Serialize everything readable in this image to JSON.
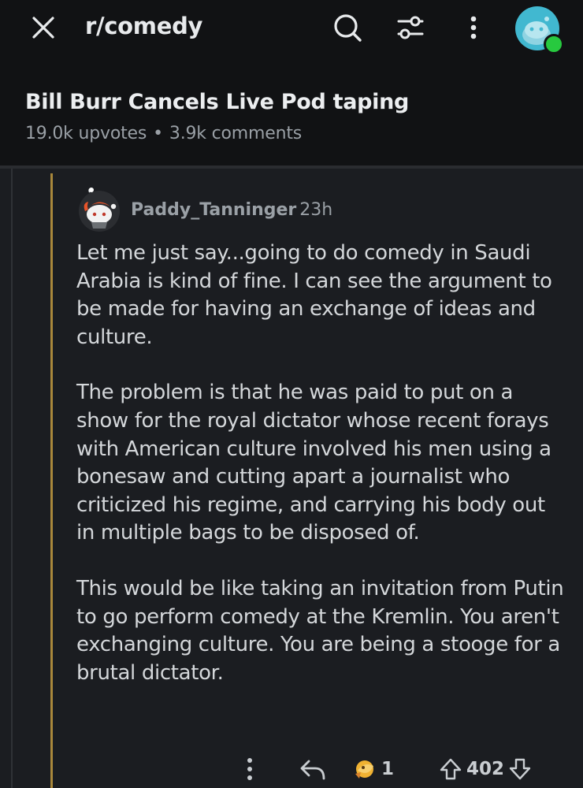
{
  "header": {
    "subreddit": "r/comedy",
    "icons": [
      "close-icon",
      "search-icon",
      "filter-icon",
      "more-vertical-icon",
      "user-avatar"
    ]
  },
  "post": {
    "title": "Bill Burr Cancels Live Pod taping",
    "upvotes": "19.0k upvotes",
    "separator": "•",
    "comments": "3.9k comments"
  },
  "comment": {
    "author": "Paddy_Tanninger",
    "age": "23h",
    "paragraphs": [
      "Let me just say...going to do comedy in Saudi Arabia is kind of fine. I can see the argument to be made for having an exchange of ideas and culture.",
      "The problem is that he was paid to put on a show for the royal dictator whose recent forays with American culture involved his men using a bonesaw and cutting apart a journalist who criticized his regime, and carrying his body out in multiple bags to be disposed of.",
      "This would be like taking an invitation from Putin to go perform comedy at the Kremlin. You aren't exchanging culture. You are being a stooge for a brutal dictator."
    ],
    "award_count": "1",
    "score": "402"
  },
  "colors": {
    "background": "#1b1d21",
    "header_background": "#111214",
    "thread_line": "#a9883b",
    "online": "#27c93f"
  }
}
